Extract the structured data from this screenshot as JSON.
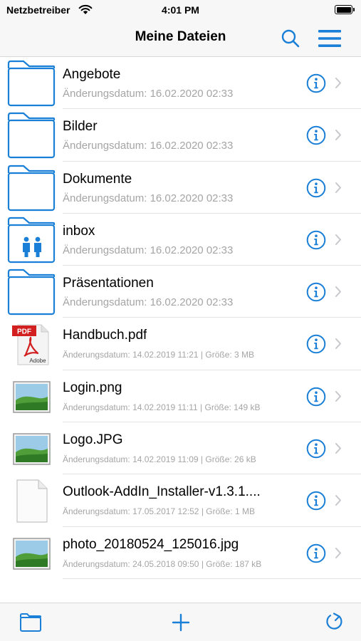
{
  "status_bar": {
    "carrier": "Netzbetreiber",
    "time": "4:01 PM"
  },
  "nav": {
    "title": "Meine Dateien",
    "search_icon": "search-icon",
    "menu_icon": "hamburger-menu-icon"
  },
  "colors": {
    "accent": "#1a7fd6",
    "meta_text": "#a5a5a5",
    "separator": "#e3e3e3",
    "bar_background": "#f7f7f7"
  },
  "files": [
    {
      "name": "Angebote",
      "meta": "Änderungsdatum: 16.02.2020 02:33",
      "kind": "folder"
    },
    {
      "name": "Bilder",
      "meta": "Änderungsdatum: 16.02.2020 02:33",
      "kind": "folder"
    },
    {
      "name": "Dokumente",
      "meta": "Änderungsdatum: 16.02.2020 02:33",
      "kind": "folder"
    },
    {
      "name": "inbox",
      "meta": "Änderungsdatum: 16.02.2020 02:33",
      "kind": "shared-folder"
    },
    {
      "name": "Präsentationen",
      "meta": "Änderungsdatum: 16.02.2020 02:33",
      "kind": "folder"
    },
    {
      "name": "Handbuch.pdf",
      "meta": "Änderungsdatum: 14.02.2019 11:21 | Größe: 3 MB",
      "kind": "pdf",
      "pdf_badge": "PDF",
      "pdf_brand": "Adobe"
    },
    {
      "name": "Login.png",
      "meta": "Änderungsdatum: 14.02.2019 11:11 | Größe: 149 kB",
      "kind": "image"
    },
    {
      "name": "Logo.JPG",
      "meta": "Änderungsdatum: 14.02.2019 11:09 | Größe: 26 kB",
      "kind": "image"
    },
    {
      "name": "Outlook-AddIn_Installer-v1.3.1....",
      "meta": "Änderungsdatum: 17.05.2017 12:52 | Größe: 1 MB",
      "kind": "document"
    },
    {
      "name": "photo_20180524_125016.jpg",
      "meta": "Änderungsdatum: 24.05.2018 09:50 | Größe: 187 kB",
      "kind": "image"
    }
  ],
  "toolbar": {
    "folder_icon": "folder-icon",
    "add_icon": "plus-icon",
    "refresh_icon": "refresh-icon"
  }
}
